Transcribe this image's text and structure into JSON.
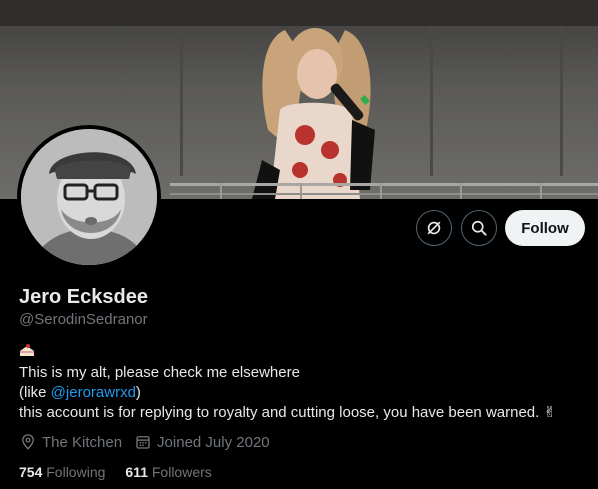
{
  "profile": {
    "display_name": "Jero Ecksdee",
    "handle": "@SerodinSedranor",
    "bio": {
      "emoji_icon": "cake-icon",
      "line1": "This is my alt, please check me elsewhere",
      "line2_prefix": "(like ",
      "line2_link": "@jerorawrxd",
      "line2_suffix": ")",
      "line3": "this account is for replying to royalty and cutting loose, you have been warned. ✌"
    },
    "location": "The Kitchen",
    "joined": "Joined July 2020",
    "following_count": "754",
    "following_label": "Following",
    "followers_count": "611",
    "followers_label": "Followers"
  },
  "actions": {
    "grok_icon": "grok-icon",
    "search_icon": "search-icon",
    "follow_label": "Follow"
  },
  "colors": {
    "background": "#000000",
    "primary_text": "#e7e9ea",
    "secondary_text": "#71767b",
    "link": "#1d9bf0",
    "follow_bg": "#eff3f4"
  }
}
